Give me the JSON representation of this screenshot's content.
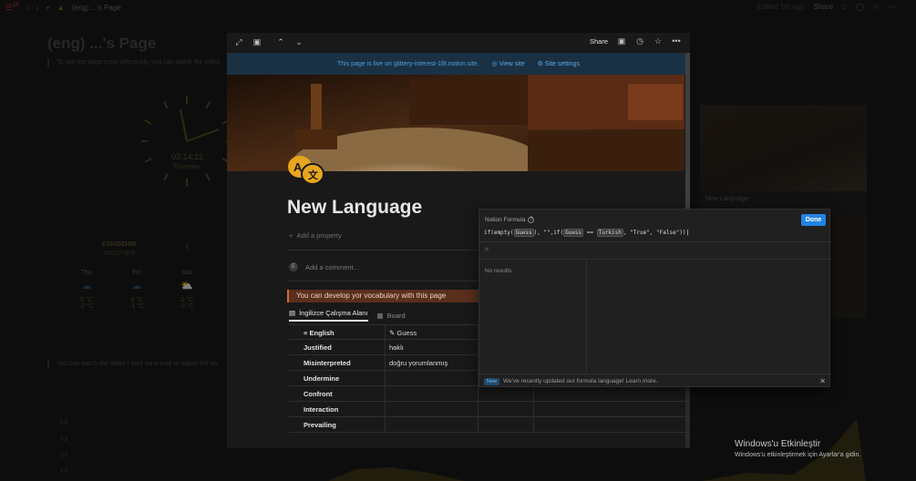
{
  "topbar": {
    "breadcrumb": "(eng) ...'s Page",
    "edited": "Edited 1m ago",
    "share": "Share",
    "notif_count": "15"
  },
  "background": {
    "title": "(eng) ...'s Page",
    "hint1": "To use the page more effectively, you can watch the video",
    "hint2": "You can watch the video I sent via e-mail to adjust the we",
    "clock_time": "03:14:12",
    "clock_day": "Thursday",
    "city": "ESKISEHIR",
    "city_sub": "WEATHER",
    "days": [
      {
        "day": "Thu",
        "hi": "5 °C",
        "lo": "-2 °C"
      },
      {
        "day": "Fri",
        "hi": "4 °C",
        "lo": "-1 °C"
      },
      {
        "day": "Sat",
        "hi": "3 °C",
        "lo": "-2 °C"
      }
    ],
    "right_card_label": "New Language",
    "chart_ticks": [
      "0.9",
      "0.8",
      "0.7",
      "0.6"
    ]
  },
  "windows_activation": {
    "title": "Windows'u Etkinleştir",
    "subtitle": "Windows'u etkinleştirmek için Ayarlar'a gidin."
  },
  "modal": {
    "share": "Share",
    "banner": {
      "text": "This page is live on glittery-interest-1f8.notion.site.",
      "view_site": "View site",
      "site_settings": "Site settings"
    },
    "title": "New Language",
    "add_property": "Add a property",
    "add_comment": "Add a comment...",
    "callout": "You can develop yor vocabulary with this page",
    "tabs": [
      {
        "label": "İngilizce Çalışma Alanı",
        "active": true
      },
      {
        "label": "Board",
        "active": false
      }
    ],
    "columns": [
      "English",
      "Guess"
    ],
    "rows": [
      {
        "english": "Justified",
        "guess": "haklı"
      },
      {
        "english": "Misinterpreted",
        "guess": "doğru yorumlanmış"
      },
      {
        "english": "Undermine",
        "guess": ""
      },
      {
        "english": "Confront",
        "guess": ""
      },
      {
        "english": "Interaction",
        "guess": ""
      },
      {
        "english": "Prevailing",
        "guess": ""
      }
    ]
  },
  "formula": {
    "title": "Notion Formula",
    "done": "Done",
    "code_parts": {
      "p1": "if(empty(",
      "guess1": "Guess",
      "p2": "), \"\",if(",
      "guess2": "Guess",
      "p3": " == ",
      "turkish": "Turkish",
      "p4": ", \"True\", \"False\"))"
    },
    "eq": "=",
    "no_results": "No results",
    "footer_badge": "New",
    "footer_text": "We've recently updated our formula language! Learn more."
  }
}
